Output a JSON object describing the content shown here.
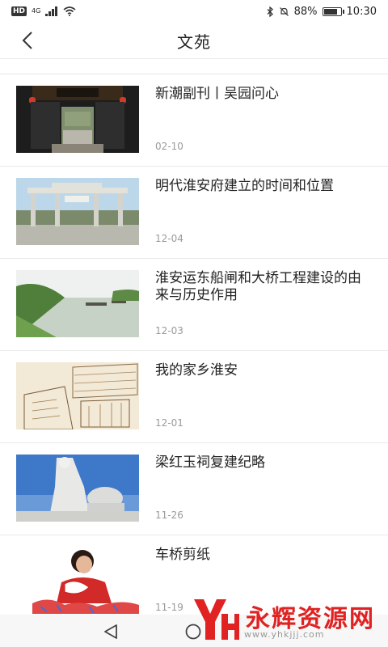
{
  "status_bar": {
    "hd": "HD",
    "network": "4G",
    "battery_text": "88%",
    "battery_level": 0.88,
    "time": "10:30"
  },
  "header": {
    "title": "文苑"
  },
  "articles": [
    {
      "title": "新潮副刊丨吴园问心",
      "date": "02-10",
      "thumb": "gate-icon"
    },
    {
      "title": "明代淮安府建立的时间和位置",
      "date": "12-04",
      "thumb": "archway-icon"
    },
    {
      "title": "淮安运东船闸和大桥工程建设的由来与历史作用",
      "date": "12-03",
      "thumb": "river-icon"
    },
    {
      "title": "我的家乡淮安",
      "date": "12-01",
      "thumb": "sketch-icon"
    },
    {
      "title": "梁红玉祠复建纪略",
      "date": "11-26",
      "thumb": "statue-icon"
    },
    {
      "title": "车桥剪纸",
      "date": "11-19",
      "thumb": "papercut-icon"
    }
  ],
  "watermark": {
    "logo": "YH",
    "text": "永辉资源网",
    "url": "www.yhkjjj.com"
  }
}
